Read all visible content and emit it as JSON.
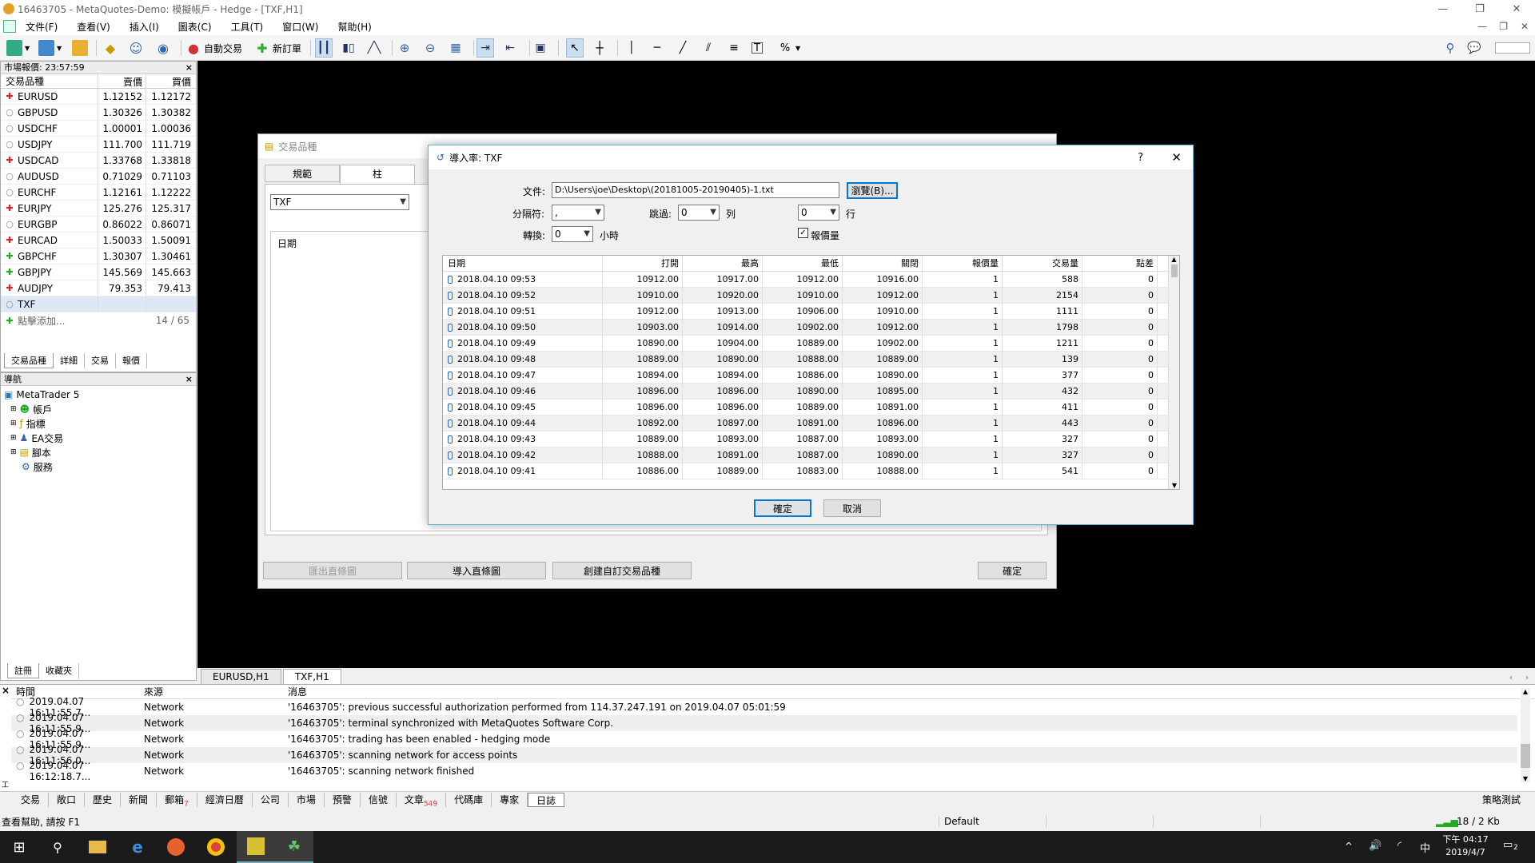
{
  "window": {
    "title": "16463705 - MetaQuotes-Demo: 模擬帳戶 - Hedge - [TXF,H1]"
  },
  "menu": [
    "文件(F)",
    "查看(V)",
    "插入(I)",
    "圖表(C)",
    "工具(T)",
    "窗口(W)",
    "幫助(H)"
  ],
  "toolbar": {
    "auto_trade": "自動交易",
    "new_order": "新訂單"
  },
  "market_watch": {
    "title": "市場報價: 23:57:59",
    "col_symbol": "交易品種",
    "col_bid": "賣價",
    "col_ask": "買價",
    "rows": [
      {
        "dir": "red",
        "sym": "EURUSD",
        "bid": "1.12152",
        "ask": "1.12172"
      },
      {
        "dir": "gray",
        "sym": "GBPUSD",
        "bid": "1.30326",
        "ask": "1.30382"
      },
      {
        "dir": "gray",
        "sym": "USDCHF",
        "bid": "1.00001",
        "ask": "1.00036"
      },
      {
        "dir": "gray",
        "sym": "USDJPY",
        "bid": "111.700",
        "ask": "111.719"
      },
      {
        "dir": "red",
        "sym": "USDCAD",
        "bid": "1.33768",
        "ask": "1.33818"
      },
      {
        "dir": "gray",
        "sym": "AUDUSD",
        "bid": "0.71029",
        "ask": "0.71103"
      },
      {
        "dir": "gray",
        "sym": "EURCHF",
        "bid": "1.12161",
        "ask": "1.12222"
      },
      {
        "dir": "red",
        "sym": "EURJPY",
        "bid": "125.276",
        "ask": "125.317"
      },
      {
        "dir": "gray",
        "sym": "EURGBP",
        "bid": "0.86022",
        "ask": "0.86071"
      },
      {
        "dir": "red",
        "sym": "EURCAD",
        "bid": "1.50033",
        "ask": "1.50091"
      },
      {
        "dir": "green",
        "sym": "GBPCHF",
        "bid": "1.30307",
        "ask": "1.30461"
      },
      {
        "dir": "green",
        "sym": "GBPJPY",
        "bid": "145.569",
        "ask": "145.663"
      },
      {
        "dir": "red",
        "sym": "AUDJPY",
        "bid": "79.353",
        "ask": "79.413"
      },
      {
        "dir": "gray",
        "sym": "TXF",
        "bid": "",
        "ask": ""
      }
    ],
    "add_label": "點擊添加...",
    "count": "14 / 65",
    "tabs": [
      "交易品種",
      "詳細",
      "交易",
      "報價"
    ]
  },
  "navigator": {
    "title": "導航",
    "root": "MetaTrader 5",
    "items": [
      "帳戶",
      "指標",
      "EA交易",
      "腳本",
      "服務"
    ],
    "tabs": [
      "註冊",
      "收藏夾"
    ]
  },
  "symbols_dialog": {
    "title": "交易品種",
    "tabs": [
      "規範",
      "柱"
    ],
    "symbol_value": "TXF",
    "list_header": "日期",
    "btn_export": "匯出直條圖",
    "btn_import": "導入直條圖",
    "btn_create": "創建自訂交易品種",
    "btn_ok": "確定"
  },
  "import_dialog": {
    "title": "導入率: TXF",
    "file_label": "文件:",
    "file_value": "D:\\Users\\joe\\Desktop\\(20181005-20190405)-1.txt",
    "browse": "瀏覽(B)...",
    "sep_label": "分隔符:",
    "sep_value": ",",
    "skip_label": "跳過:",
    "skip_cols_value": "0",
    "cols_unit": "列",
    "skip_rows_value": "0",
    "rows_unit": "行",
    "shift_label": "轉換:",
    "shift_value": "0",
    "shift_unit": "小時",
    "tickvol_label": "報價量",
    "columns": [
      "日期",
      "打開",
      "最高",
      "最低",
      "關閉",
      "報價量",
      "交易量",
      "點差"
    ],
    "rows": [
      [
        "2018.04.10 09:53",
        "10912.00",
        "10917.00",
        "10912.00",
        "10916.00",
        "1",
        "588",
        "0"
      ],
      [
        "2018.04.10 09:52",
        "10910.00",
        "10920.00",
        "10910.00",
        "10912.00",
        "1",
        "2154",
        "0"
      ],
      [
        "2018.04.10 09:51",
        "10912.00",
        "10913.00",
        "10906.00",
        "10910.00",
        "1",
        "1111",
        "0"
      ],
      [
        "2018.04.10 09:50",
        "10903.00",
        "10914.00",
        "10902.00",
        "10912.00",
        "1",
        "1798",
        "0"
      ],
      [
        "2018.04.10 09:49",
        "10890.00",
        "10904.00",
        "10889.00",
        "10902.00",
        "1",
        "1211",
        "0"
      ],
      [
        "2018.04.10 09:48",
        "10889.00",
        "10890.00",
        "10888.00",
        "10889.00",
        "1",
        "139",
        "0"
      ],
      [
        "2018.04.10 09:47",
        "10894.00",
        "10894.00",
        "10886.00",
        "10890.00",
        "1",
        "377",
        "0"
      ],
      [
        "2018.04.10 09:46",
        "10896.00",
        "10896.00",
        "10890.00",
        "10895.00",
        "1",
        "432",
        "0"
      ],
      [
        "2018.04.10 09:45",
        "10896.00",
        "10896.00",
        "10889.00",
        "10891.00",
        "1",
        "411",
        "0"
      ],
      [
        "2018.04.10 09:44",
        "10892.00",
        "10897.00",
        "10891.00",
        "10896.00",
        "1",
        "443",
        "0"
      ],
      [
        "2018.04.10 09:43",
        "10889.00",
        "10893.00",
        "10887.00",
        "10893.00",
        "1",
        "327",
        "0"
      ],
      [
        "2018.04.10 09:42",
        "10888.00",
        "10891.00",
        "10887.00",
        "10890.00",
        "1",
        "327",
        "0"
      ],
      [
        "2018.04.10 09:41",
        "10886.00",
        "10889.00",
        "10883.00",
        "10888.00",
        "1",
        "541",
        "0"
      ]
    ],
    "ok": "確定",
    "cancel": "取消"
  },
  "chart_tabs": [
    "EURUSD,H1",
    "TXF,H1"
  ],
  "log": {
    "col_time": "時間",
    "col_source": "來源",
    "col_message": "消息",
    "rows": [
      {
        "time": "2019.04.07 16:11:55.7...",
        "src": "Network",
        "msg": "'16463705': previous successful authorization performed from 114.37.247.191 on 2019.04.07 05:01:59"
      },
      {
        "time": "2019.04.07 16:11:55.9...",
        "src": "Network",
        "msg": "'16463705': terminal synchronized with MetaQuotes Software Corp."
      },
      {
        "time": "2019.04.07 16:11:55.9...",
        "src": "Network",
        "msg": "'16463705': trading has been enabled - hedging mode"
      },
      {
        "time": "2019.04.07 16:11:56.0...",
        "src": "Network",
        "msg": "'16463705': scanning network for access points"
      },
      {
        "time": "2019.04.07 16:12:18.7...",
        "src": "Network",
        "msg": "'16463705': scanning network finished"
      }
    ]
  },
  "bottom_tabs": [
    {
      "label": "交易"
    },
    {
      "label": "敞口"
    },
    {
      "label": "歷史"
    },
    {
      "label": "新聞"
    },
    {
      "label": "郵箱",
      "badge": "7"
    },
    {
      "label": "經濟日曆"
    },
    {
      "label": "公司"
    },
    {
      "label": "市場"
    },
    {
      "label": "預警"
    },
    {
      "label": "信號"
    },
    {
      "label": "文章",
      "badge": "549"
    },
    {
      "label": "代碼庫"
    },
    {
      "label": "專家"
    },
    {
      "label": "日誌"
    }
  ],
  "strategy_tester": "策略測試",
  "toolbox_side": "工具箱",
  "status": {
    "help": "查看幫助, 請按 F1",
    "profile": "Default",
    "traffic": "18 / 2 Kb"
  },
  "taskbar": {
    "time": "下午 04:17",
    "date": "2019/4/7",
    "ime": "中",
    "notif": "2"
  }
}
